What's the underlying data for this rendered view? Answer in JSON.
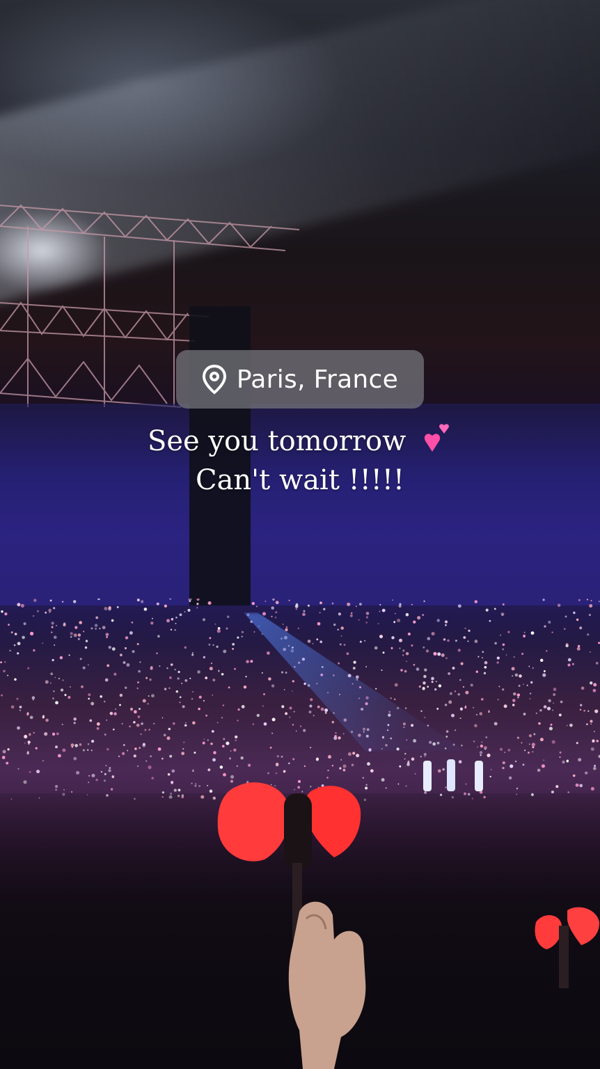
{
  "location_sticker": {
    "icon": "map-pin-icon",
    "label": "Paris, France"
  },
  "caption": {
    "line1": "See you tomorrow",
    "line1_emoji": "two-hearts-icon",
    "line2": "Can't wait !!!!!"
  },
  "colors": {
    "sticker_bg": "#78787f",
    "text": "#ffffff",
    "heart_pink": "#ff4fa8",
    "lightstick_red": "#ff3b3b"
  }
}
